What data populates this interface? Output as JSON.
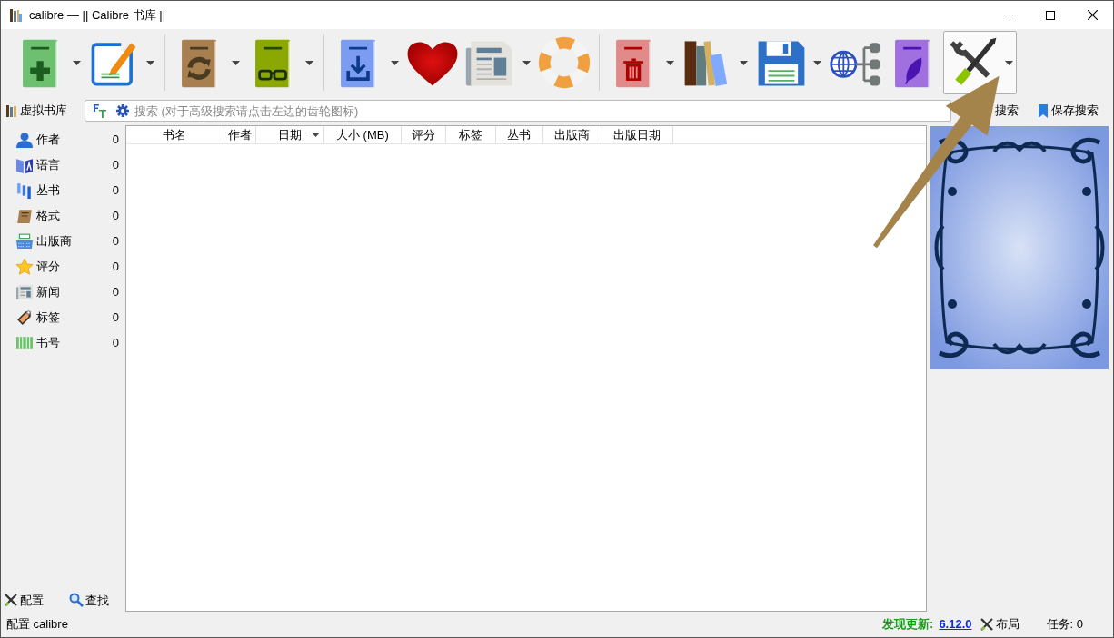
{
  "window": {
    "title": "calibre — || Calibre 书库 ||"
  },
  "toolbar": {
    "groups": [
      [
        {
          "dropdown": true,
          "highlighted": false
        },
        {
          "dropdown": true,
          "highlighted": false
        }
      ],
      [
        {
          "dropdown": true,
          "highlighted": false
        },
        {
          "dropdown": true,
          "highlighted": false
        }
      ],
      [
        {
          "dropdown": true,
          "highlighted": false
        },
        {
          "dropdown": false,
          "highlighted": false
        },
        {
          "dropdown": true,
          "highlighted": false
        },
        {
          "dropdown": false,
          "highlighted": false
        }
      ],
      [
        {
          "dropdown": true,
          "highlighted": false
        },
        {
          "dropdown": true,
          "highlighted": false
        },
        {
          "dropdown": true,
          "highlighted": false
        },
        {
          "dropdown": false,
          "highlighted": false
        },
        {
          "dropdown": false,
          "highlighted": false
        },
        {
          "dropdown": true,
          "highlighted": true
        }
      ]
    ]
  },
  "search_row": {
    "virtual_library": "虚拟书库",
    "search": {
      "placeholder": "搜索 (对于高级搜索请点击左边的齿轮图标)"
    },
    "advanced_search": "搜索",
    "save_search": "保存搜索"
  },
  "sidebar": {
    "items": [
      {
        "label": "作者",
        "count": "0"
      },
      {
        "label": "语言",
        "count": "0"
      },
      {
        "label": "丛书",
        "count": "0"
      },
      {
        "label": "格式",
        "count": "0"
      },
      {
        "label": "出版商",
        "count": "0"
      },
      {
        "label": "评分",
        "count": "0"
      },
      {
        "label": "新闻",
        "count": "0"
      },
      {
        "label": "标签",
        "count": "0"
      },
      {
        "label": "书号",
        "count": "0"
      }
    ],
    "buttons": [
      "配置",
      "查找"
    ]
  },
  "table": {
    "columns": [
      {
        "label": "书名",
        "sorted": false
      },
      {
        "label": "作者",
        "sorted": false
      },
      {
        "label": "日期",
        "sorted": true
      },
      {
        "label": "大小 (MB)",
        "sorted": false
      },
      {
        "label": "评分",
        "sorted": false
      },
      {
        "label": "标签",
        "sorted": false
      },
      {
        "label": "丛书",
        "sorted": false
      },
      {
        "label": "出版商",
        "sorted": false
      },
      {
        "label": "出版日期",
        "sorted": false
      }
    ]
  },
  "status_bar": {
    "message": "配置 calibre",
    "update_label": "发现更新:",
    "update_version": "6.12.0",
    "layout": "布局",
    "jobs": "任务: 0"
  },
  "annotation_arrow": true
}
